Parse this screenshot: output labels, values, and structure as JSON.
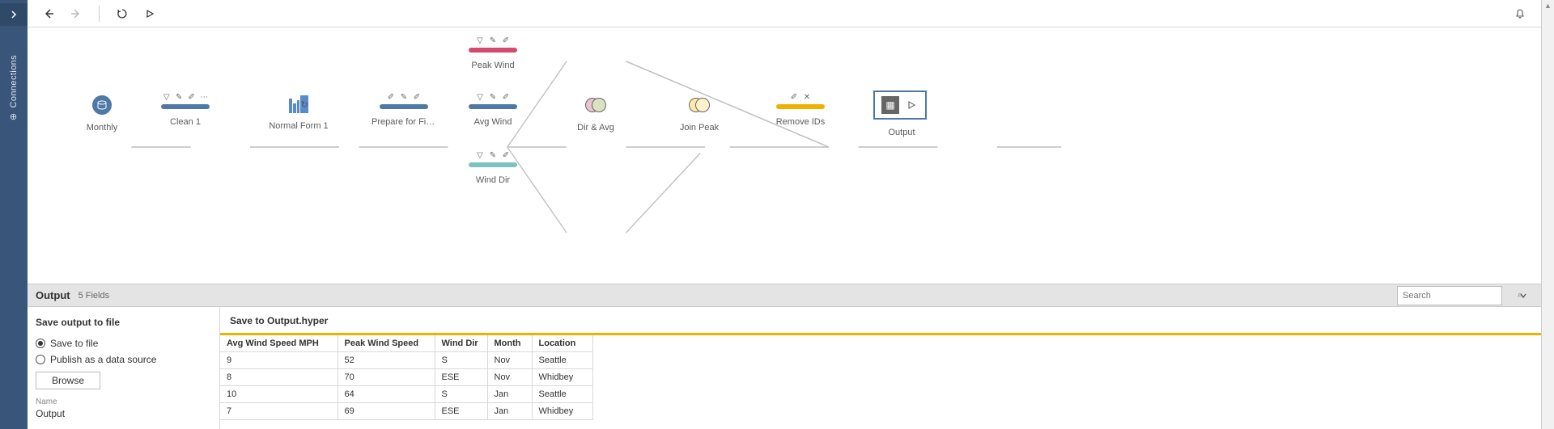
{
  "sidebar": {
    "label": "Connections"
  },
  "flow": {
    "nodes": {
      "monthly": {
        "label": "Monthly",
        "color": "#4e79a7"
      },
      "clean1": {
        "label": "Clean 1",
        "color": "#4e79a7"
      },
      "normal": {
        "label": "Normal Form 1"
      },
      "prepare": {
        "label": "Prepare for Filt...",
        "color": "#4e79a7"
      },
      "peakwind": {
        "label": "Peak Wind",
        "color": "#d64a6b"
      },
      "avgwind": {
        "label": "Avg Wind",
        "color": "#4e79a7"
      },
      "winddir": {
        "label": "Wind Dir",
        "color": "#7bc2c2"
      },
      "diravg": {
        "label": "Dir & Avg"
      },
      "joinpeak": {
        "label": "Join Peak"
      },
      "removeids": {
        "label": "Remove IDs",
        "color": "#f1b000"
      },
      "output": {
        "label": "Output"
      }
    }
  },
  "panel": {
    "title": "Output",
    "subtitle": "5 Fields",
    "search_placeholder": "Search"
  },
  "config": {
    "heading": "Save output to file",
    "radio_save": "Save to file",
    "radio_publish": "Publish as a data source",
    "browse": "Browse",
    "name_label": "Name",
    "name_value": "Output"
  },
  "preview": {
    "title": "Save to Output.hyper",
    "columns": [
      "Avg Wind Speed MPH",
      "Peak Wind Speed",
      "Wind Dir",
      "Month",
      "Location"
    ],
    "rows": [
      [
        "9",
        "52",
        "S",
        "Nov",
        "Seattle"
      ],
      [
        "8",
        "70",
        "ESE",
        "Nov",
        "Whidbey"
      ],
      [
        "10",
        "64",
        "S",
        "Jan",
        "Seattle"
      ],
      [
        "7",
        "69",
        "ESE",
        "Jan",
        "Whidbey"
      ]
    ]
  }
}
